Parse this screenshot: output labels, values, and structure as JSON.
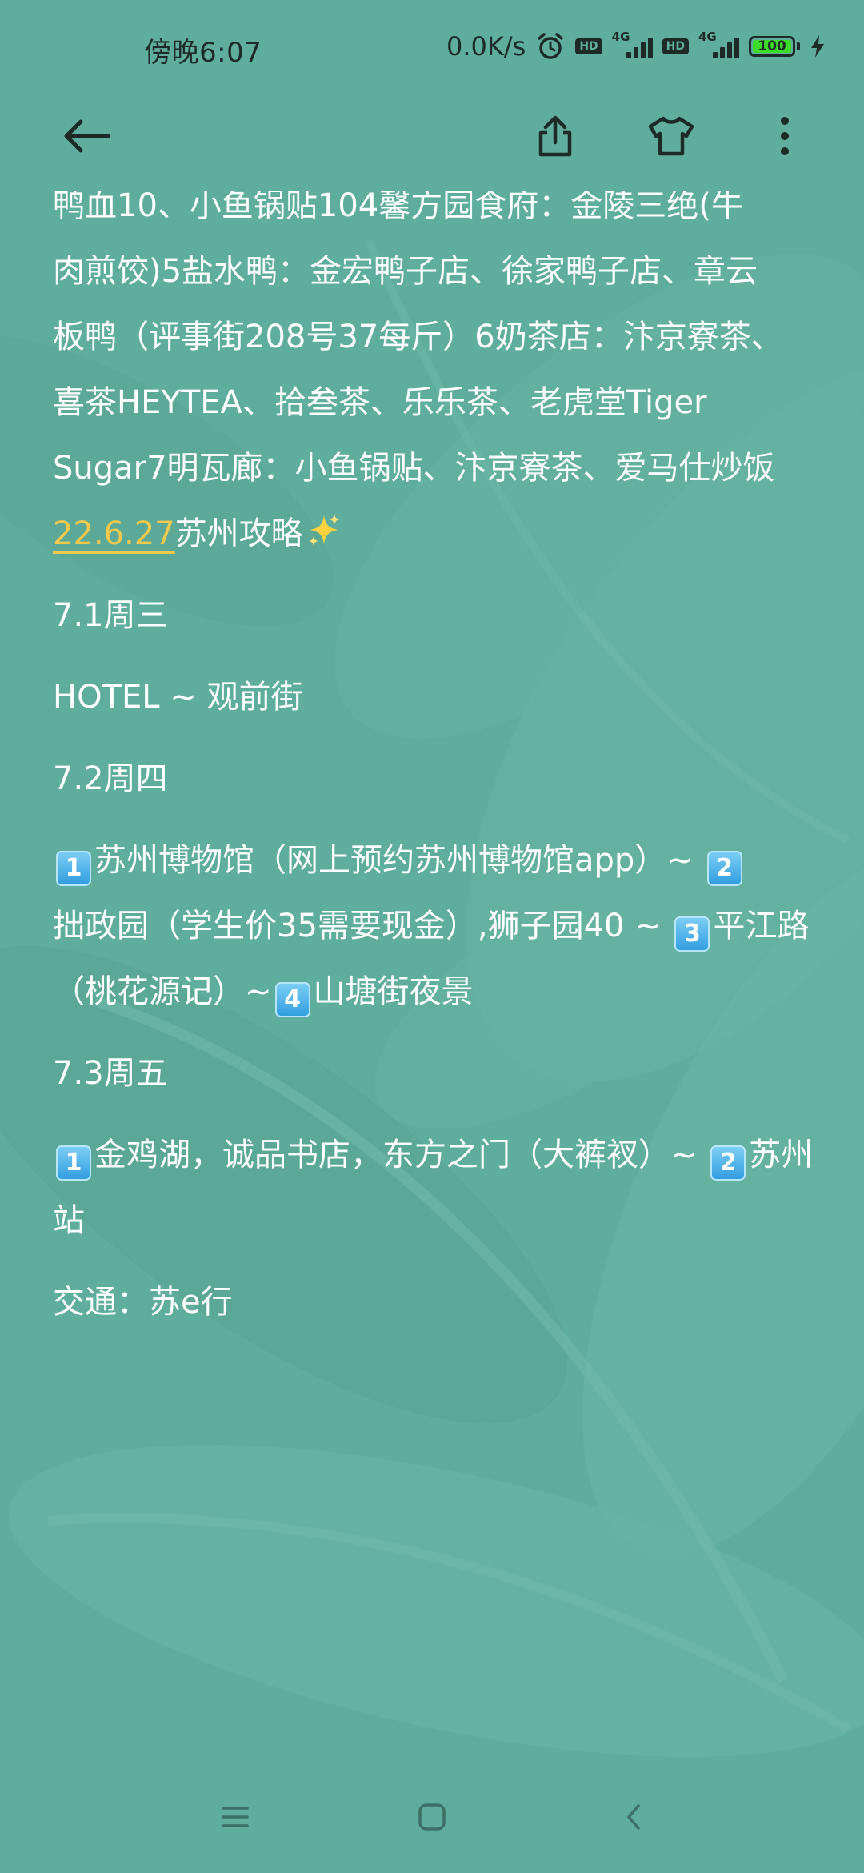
{
  "status_bar": {
    "time": "傍晚6:07",
    "net_speed": "0.0K/s",
    "hd_label": "HD",
    "network_type": "4G",
    "battery": "100"
  },
  "toolbar": {
    "back_icon": "arrow-left-icon",
    "share_icon": "share-icon",
    "theme_icon": "shirt-icon",
    "more_icon": "more-vertical-icon"
  },
  "note": {
    "intro_lines": [
      "鸭血10、小鱼锅贴104馨方园食府：金陵三绝(牛",
      "肉煎饺)5盐水鸭：金宏鸭子店、徐家鸭子店、章云",
      "板鸭（评事街208号37每斤）6奶茶店：汴京寮茶、",
      "喜茶HEYTEA、拾叁茶、乐乐茶、老虎堂Tiger",
      "Sugar7明瓦廊：小鱼锅贴、汴京寮茶、爱马仕炒饭"
    ],
    "date_link": "22.6.27",
    "title": "苏州攻略",
    "title_emoji": "sparkles-emoji",
    "day1_heading": "7.1周三",
    "day1_text": "HOTEL ~ 观前街",
    "day2_heading": "7.2周四",
    "day2_items": [
      {
        "num": "1",
        "text": "苏州博物馆（网上预约苏州博物馆app）~ "
      },
      {
        "num": "2",
        "text": "拙政园（学生价35需要现金）,狮子园40 ~ "
      },
      {
        "num": "3",
        "text": "平江路（桃花源记）~"
      },
      {
        "num": "4",
        "text": "山塘街夜景"
      }
    ],
    "day3_heading": "7.3周五",
    "day3_items": [
      {
        "num": "1",
        "text": "金鸡湖，诚品书店，东方之门（大裤衩）~ "
      },
      {
        "num": "2",
        "text": "苏州站"
      }
    ],
    "transport": "交通：苏e行"
  },
  "nav_bar": {
    "menu_icon": "menu-icon",
    "home_icon": "home-square-icon",
    "back_icon": "back-chevron-icon"
  },
  "colors": {
    "background": "#5fad9c",
    "link": "#f3c94d",
    "text": "#ffffff"
  }
}
